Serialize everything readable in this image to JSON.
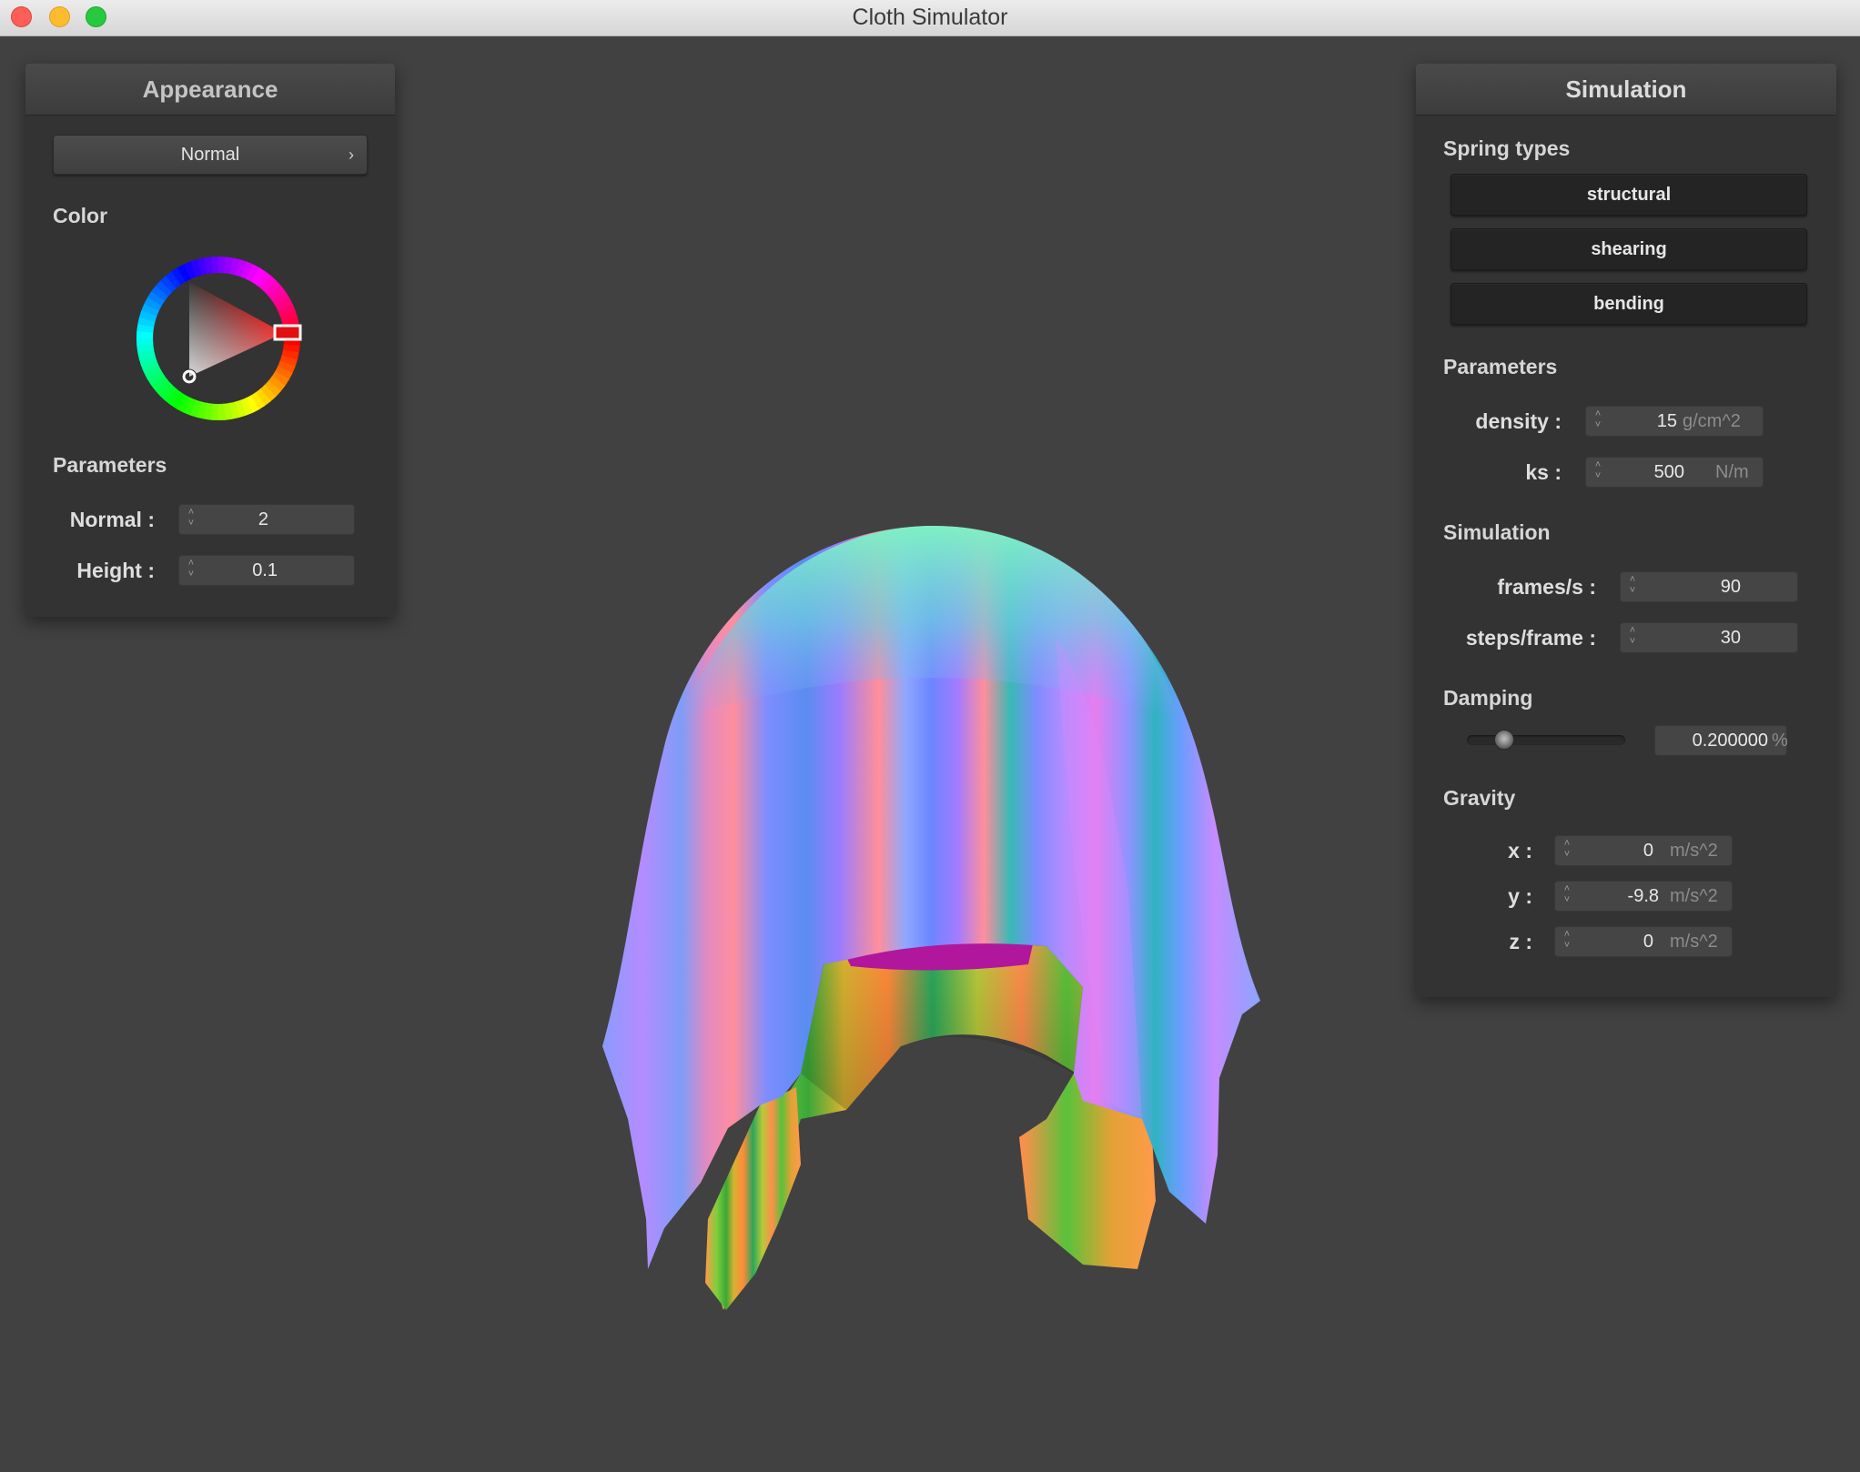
{
  "window": {
    "title": "Cloth Simulator"
  },
  "appearance": {
    "title": "Appearance",
    "shader_select": {
      "value": "Normal",
      "chevron": "›"
    },
    "color_label": "Color",
    "color_picker": {
      "hue_color": "#ff0000"
    },
    "params_label": "Parameters",
    "normal": {
      "label": "Normal :",
      "value": "2"
    },
    "height": {
      "label": "Height :",
      "value": "0.1"
    }
  },
  "simulation": {
    "title": "Simulation",
    "spring_types_label": "Spring types",
    "spring_buttons": [
      "structural",
      "shearing",
      "bending"
    ],
    "params_label": "Parameters",
    "density": {
      "label": "density :",
      "value": "15",
      "unit": "g/cm^2"
    },
    "ks": {
      "label": "ks :",
      "value": "500",
      "unit": "N/m"
    },
    "sim_label": "Simulation",
    "frames": {
      "label": "frames/s :",
      "value": "90"
    },
    "steps": {
      "label": "steps/frame :",
      "value": "30"
    },
    "damping_label": "Damping",
    "damping": {
      "value": "0.200000",
      "unit": "%",
      "slider_fraction": 0.2
    },
    "gravity_label": "Gravity",
    "gravity": [
      {
        "label": "x :",
        "value": "0",
        "unit": "m/s^2"
      },
      {
        "label": "y :",
        "value": "-9.8",
        "unit": "m/s^2"
      },
      {
        "label": "z :",
        "value": "0",
        "unit": "m/s^2"
      }
    ]
  },
  "colors": {
    "background": "#414141",
    "panel": "#333333",
    "cloth_colors": [
      "#7fb0ff",
      "#9b7cff",
      "#ff8aa0",
      "#5cd6c6",
      "#ff9a4a",
      "#4fc83a",
      "#b0179c"
    ]
  }
}
